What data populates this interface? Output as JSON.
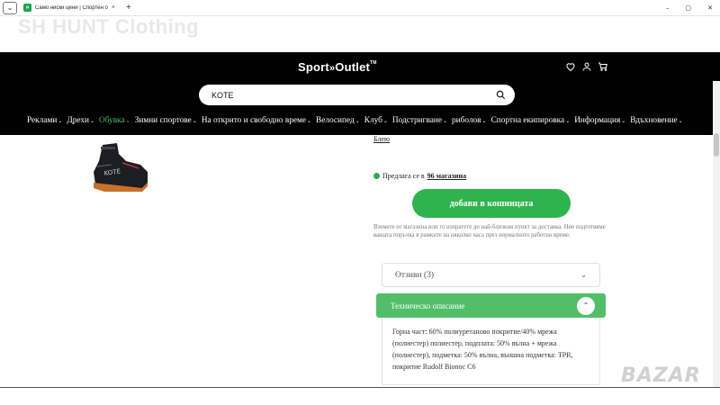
{
  "browser": {
    "tab_title": "Само ниски цени | Спортен о",
    "tab_close": "×",
    "new_tab": "+",
    "win_min": "–",
    "win_max": "▢",
    "win_close": "✕"
  },
  "watermark": "SH HUNT Clothing",
  "header": {
    "logo_part1": "Sport",
    "logo_arrows": "»",
    "logo_part2": "Outlet",
    "logo_tm": "TM",
    "icons": [
      "heart-icon",
      "user-icon",
      "cart-icon"
    ]
  },
  "search": {
    "value": "KOTE"
  },
  "nav": [
    {
      "label": "Реклами",
      "active": false
    },
    {
      "label": "Дрехи",
      "active": false
    },
    {
      "label": "Обувка",
      "active": true
    },
    {
      "label": "Зимни спортове",
      "active": false
    },
    {
      "label": "На открито и свободно време",
      "active": false
    },
    {
      "label": "Велосипед",
      "active": false
    },
    {
      "label": "Клуб",
      "active": false
    },
    {
      "label": "Подстригване",
      "active": false
    },
    {
      "label": "риболов",
      "active": false
    },
    {
      "label": "Спортна екипировка",
      "active": false
    },
    {
      "label": "Информация",
      "active": false
    },
    {
      "label": "Вдъхновение",
      "active": false
    }
  ],
  "product": {
    "color_link": "Блею",
    "availability_prefix": "Предлага се в",
    "availability_link": "96 магазина",
    "add_to_cart": "добави в кошницата",
    "delivery_note": "Вземете от магазина или го изпратете до най-близкия пункт за доставка. Ние подготвяме вашата поръчка в рамките на няколко часа през нормалното работно време.",
    "reviews_label": "Отзиви",
    "reviews_count": "(3)",
    "tech_label": "Техническо описание",
    "tech_description": "Горна част: 60% полиуретаново покритие/40% мрежа (полиестер) полиестер, подплата: 50% вълна + мрежа (полиестер), подметка: 50% вълна, външна подметка: TPR, покритие Rudolf Bionoc C6"
  },
  "footer_logo": "BAZAR"
}
